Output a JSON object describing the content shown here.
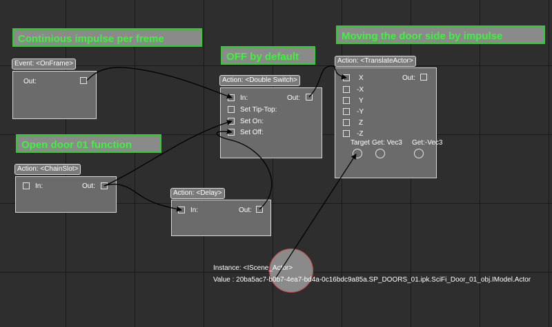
{
  "notes": {
    "impulse": "Continious impulse per freme",
    "off_default": "OFF by default",
    "moving": "Moving the door side by impulse",
    "open_door": "Open door 01 function"
  },
  "nodes": {
    "onframe": {
      "title": "Event: <OnFrame>",
      "out": "Out:"
    },
    "chainslot": {
      "title": "Action: <ChainSlot>",
      "in": "In:",
      "out": "Out:"
    },
    "doubleswitch": {
      "title": "Action: <Double Switch>",
      "in": "In:",
      "out": "Out:",
      "set_tiptop": "Set Tip-Top:",
      "set_on": "Set On:",
      "set_off": "Set Off:"
    },
    "delay": {
      "title": "Action: <Delay>",
      "in": "In:",
      "out": "Out:"
    },
    "translate": {
      "title": "Action: <TranslateActor>",
      "out": "Out:",
      "axes": [
        "X",
        "-X",
        "Y",
        "-Y",
        "Z",
        "-Z"
      ],
      "target": "Target",
      "get_vec3": "Get: Vec3",
      "get_neg_vec3": "Get:-Vec3"
    }
  },
  "instance": {
    "label": "Instance: <IScene_Actor>",
    "value": "Value : 20ba5ac7-b0b7-4ea7-bd4a-0c16bdc9a85a.SP_DOORS_01.ipk.SciFi_Door_01_obj.IModel.Actor"
  },
  "colors": {
    "canvas": "#2e2e2e",
    "grid": "#1a1a1a",
    "note_bg": "#8a8a8a",
    "note_text": "#3af53a",
    "node_bg": "#6b6b6b",
    "wire": "#000000"
  }
}
